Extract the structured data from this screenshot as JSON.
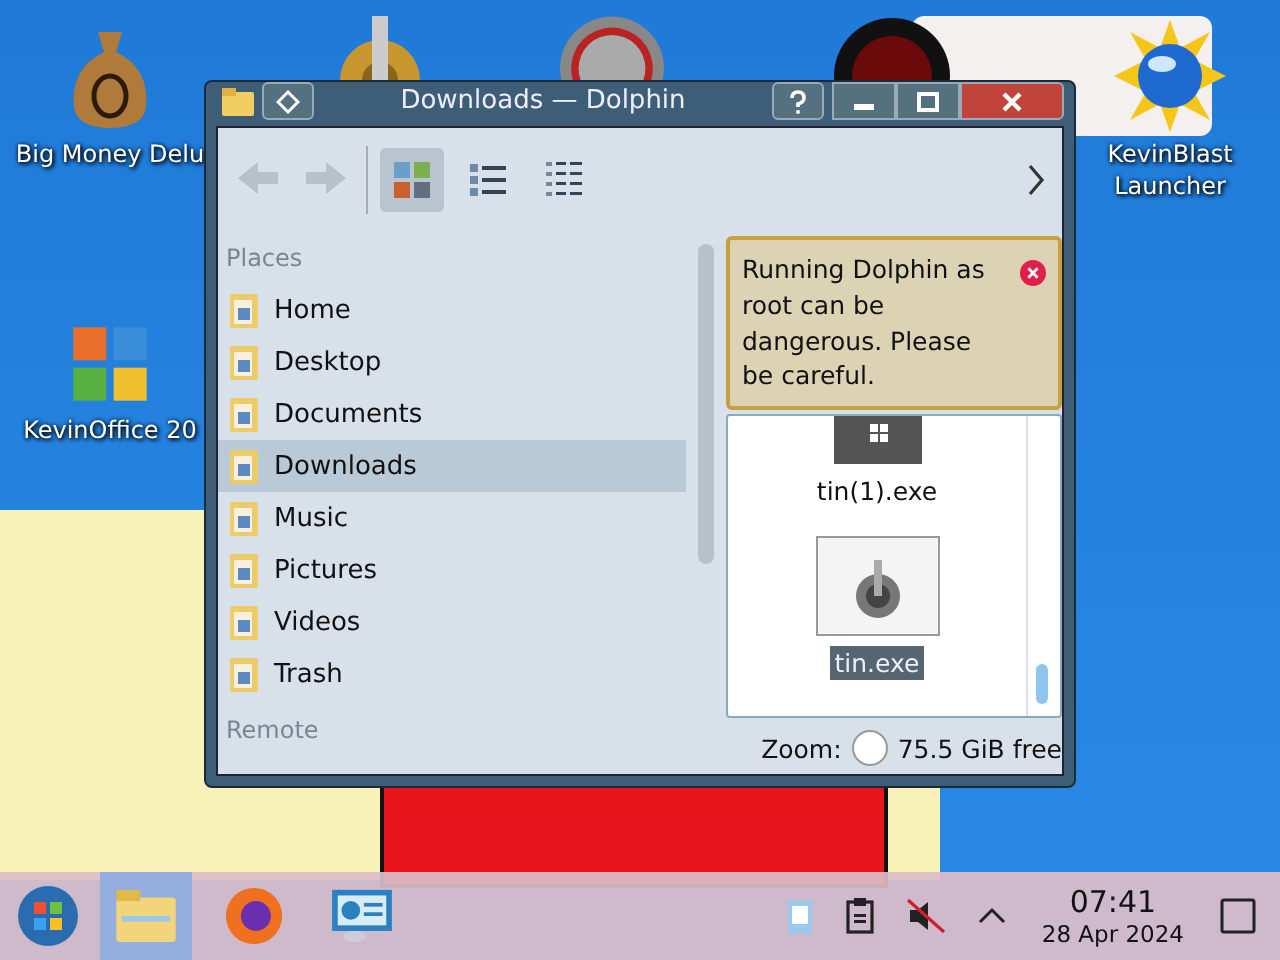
{
  "desktop_icons": [
    {
      "kind": "money",
      "label": "Big Money Delu"
    },
    {
      "kind": "office",
      "label": "KevinOffice 20"
    },
    {
      "kind": "globe",
      "label": "KevinBlast Launcher"
    }
  ],
  "window": {
    "title": "Downloads — Dolphin"
  },
  "view_modes": [
    {
      "kind": "icons",
      "selected": true
    },
    {
      "kind": "compact",
      "selected": false
    },
    {
      "kind": "details",
      "selected": false
    }
  ],
  "places": {
    "header": "Places",
    "items": [
      {
        "label": "Home",
        "selected": false
      },
      {
        "label": "Desktop",
        "selected": false
      },
      {
        "label": "Documents",
        "selected": false
      },
      {
        "label": "Downloads",
        "selected": true
      },
      {
        "label": "Music",
        "selected": false
      },
      {
        "label": "Pictures",
        "selected": false
      },
      {
        "label": "Videos",
        "selected": false
      },
      {
        "label": "Trash",
        "selected": false
      }
    ],
    "remote_header": "Remote"
  },
  "warning": {
    "text": "Running Dolphin as root can be dangerous. Please be careful."
  },
  "files": [
    {
      "name": "tin(1).exe",
      "selected": false
    },
    {
      "name": "tin.exe",
      "selected": true
    }
  ],
  "status_bar": {
    "zoom_label": "Zoom:",
    "free_space": "75.5 GiB free"
  },
  "taskbar": {
    "apps": [
      {
        "kind": "files",
        "active": true
      },
      {
        "kind": "browser",
        "active": false
      },
      {
        "kind": "monitor",
        "active": false
      }
    ],
    "time": "07:41",
    "date": "28 Apr 2024"
  }
}
